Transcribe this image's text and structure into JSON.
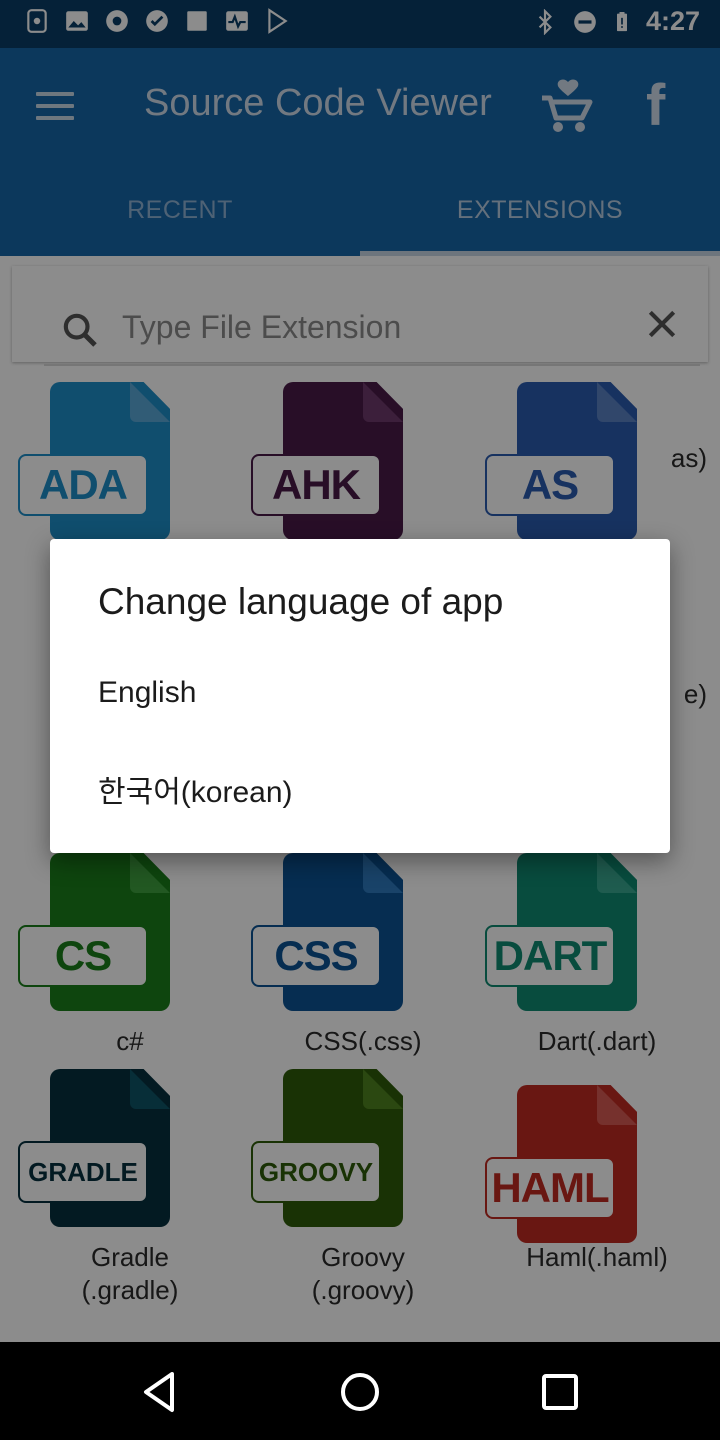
{
  "status_bar": {
    "time": "4:27",
    "left_icons": [
      "screenshot-icon",
      "image-icon",
      "record-icon",
      "check-badge-icon",
      "square-icon",
      "activity-icon",
      "play-store-icon"
    ],
    "right_icons": [
      "bluetooth-icon",
      "do-not-disturb-icon",
      "battery-icon"
    ]
  },
  "app_bar": {
    "title": "Source Code Viewer",
    "menu_icon": "hamburger-menu-icon",
    "cart_icon": "heart-cart-icon",
    "facebook_icon": "facebook-icon",
    "facebook_glyph": "f",
    "background": "#1766a8"
  },
  "tabs": [
    {
      "label": "RECENT",
      "selected": false
    },
    {
      "label": "EXTENSIONS",
      "selected": true
    }
  ],
  "search": {
    "placeholder": "Type File Extension",
    "value": ""
  },
  "extensions": [
    {
      "tag": "ADA",
      "label": "",
      "color": "#1e8ec8",
      "fold": "#5aa8d8"
    },
    {
      "tag": "AHK",
      "label": "",
      "color": "#4a1a48",
      "fold": "#6e3a6c"
    },
    {
      "tag": "AS",
      "label": "as)",
      "color": "#2a5bb0",
      "fold": "#5a82c4"
    },
    {
      "tag": "",
      "label": "",
      "color": "#444444",
      "fold": "#666666"
    },
    {
      "tag": "",
      "label": "",
      "color": "#444444",
      "fold": "#666666"
    },
    {
      "tag": "",
      "label": "e)",
      "color": "#444444",
      "fold": "#666666"
    },
    {
      "tag": "CS",
      "label": "c#",
      "color": "#1a7f1a",
      "fold": "#3fa13f"
    },
    {
      "tag": "CSS",
      "label": "CSS(.css)",
      "color": "#0b5394",
      "fold": "#2f7ac0"
    },
    {
      "tag": "DART",
      "label": "Dart(.dart)",
      "color": "#0f8a72",
      "fold": "#3aa890"
    },
    {
      "tag": "GRADLE",
      "label": "Gradle\n(.gradle)",
      "color": "#06303e",
      "fold": "#0e5566"
    },
    {
      "tag": "GROOVY",
      "label": "Groovy\n(.groovy)",
      "color": "#2f5c0a",
      "fold": "#4f8420"
    },
    {
      "tag": "HAML",
      "label": "Haml(.haml)",
      "color": "#c02a22",
      "fold": "#d85a52"
    }
  ],
  "dialog": {
    "title": "Change language of app",
    "options": [
      "English",
      "한국어(korean)"
    ]
  },
  "nav_bar": {
    "icons": [
      "back-icon",
      "home-icon",
      "recents-icon"
    ]
  }
}
